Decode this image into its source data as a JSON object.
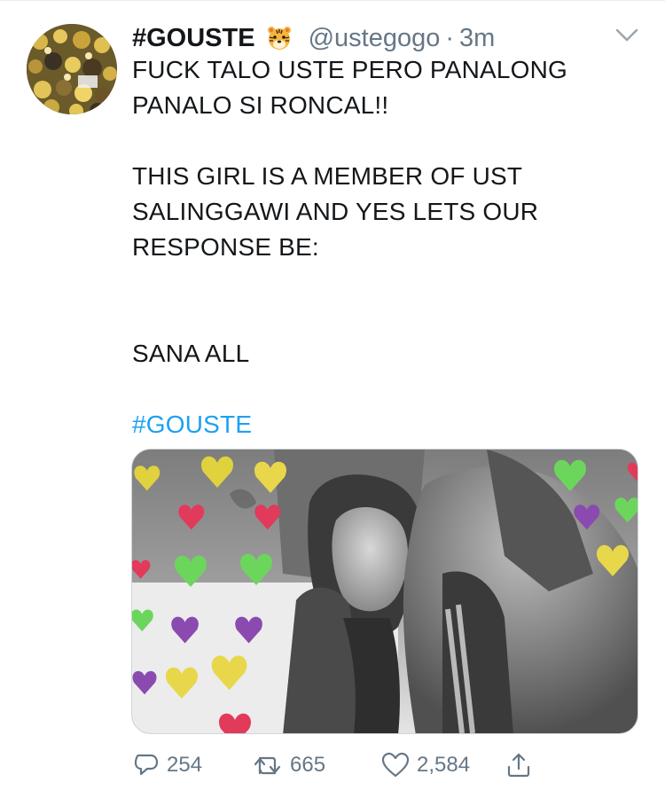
{
  "tweet": {
    "display_name": "#GOUSTE",
    "handle": "@ustegogo",
    "separator": "·",
    "time": "3m",
    "text_lines": [
      "FUCK TALO USTE PERO PANALONG",
      "PANALO SI RONCAL!!",
      "",
      "THIS GIRL IS A MEMBER OF UST",
      "SALINGGAWI AND YES LETS OUR",
      "RESPONSE BE:",
      "",
      "",
      "SANA ALL",
      "",
      "#GOUSTE"
    ],
    "hashtag": "#GOUSTE",
    "emoji_icon": "tiger-face-icon",
    "link_color": "#1da1f2",
    "secondary_color": "#657786"
  },
  "actions": {
    "reply_count": "254",
    "retweet_count": "665",
    "like_count": "2,584"
  }
}
